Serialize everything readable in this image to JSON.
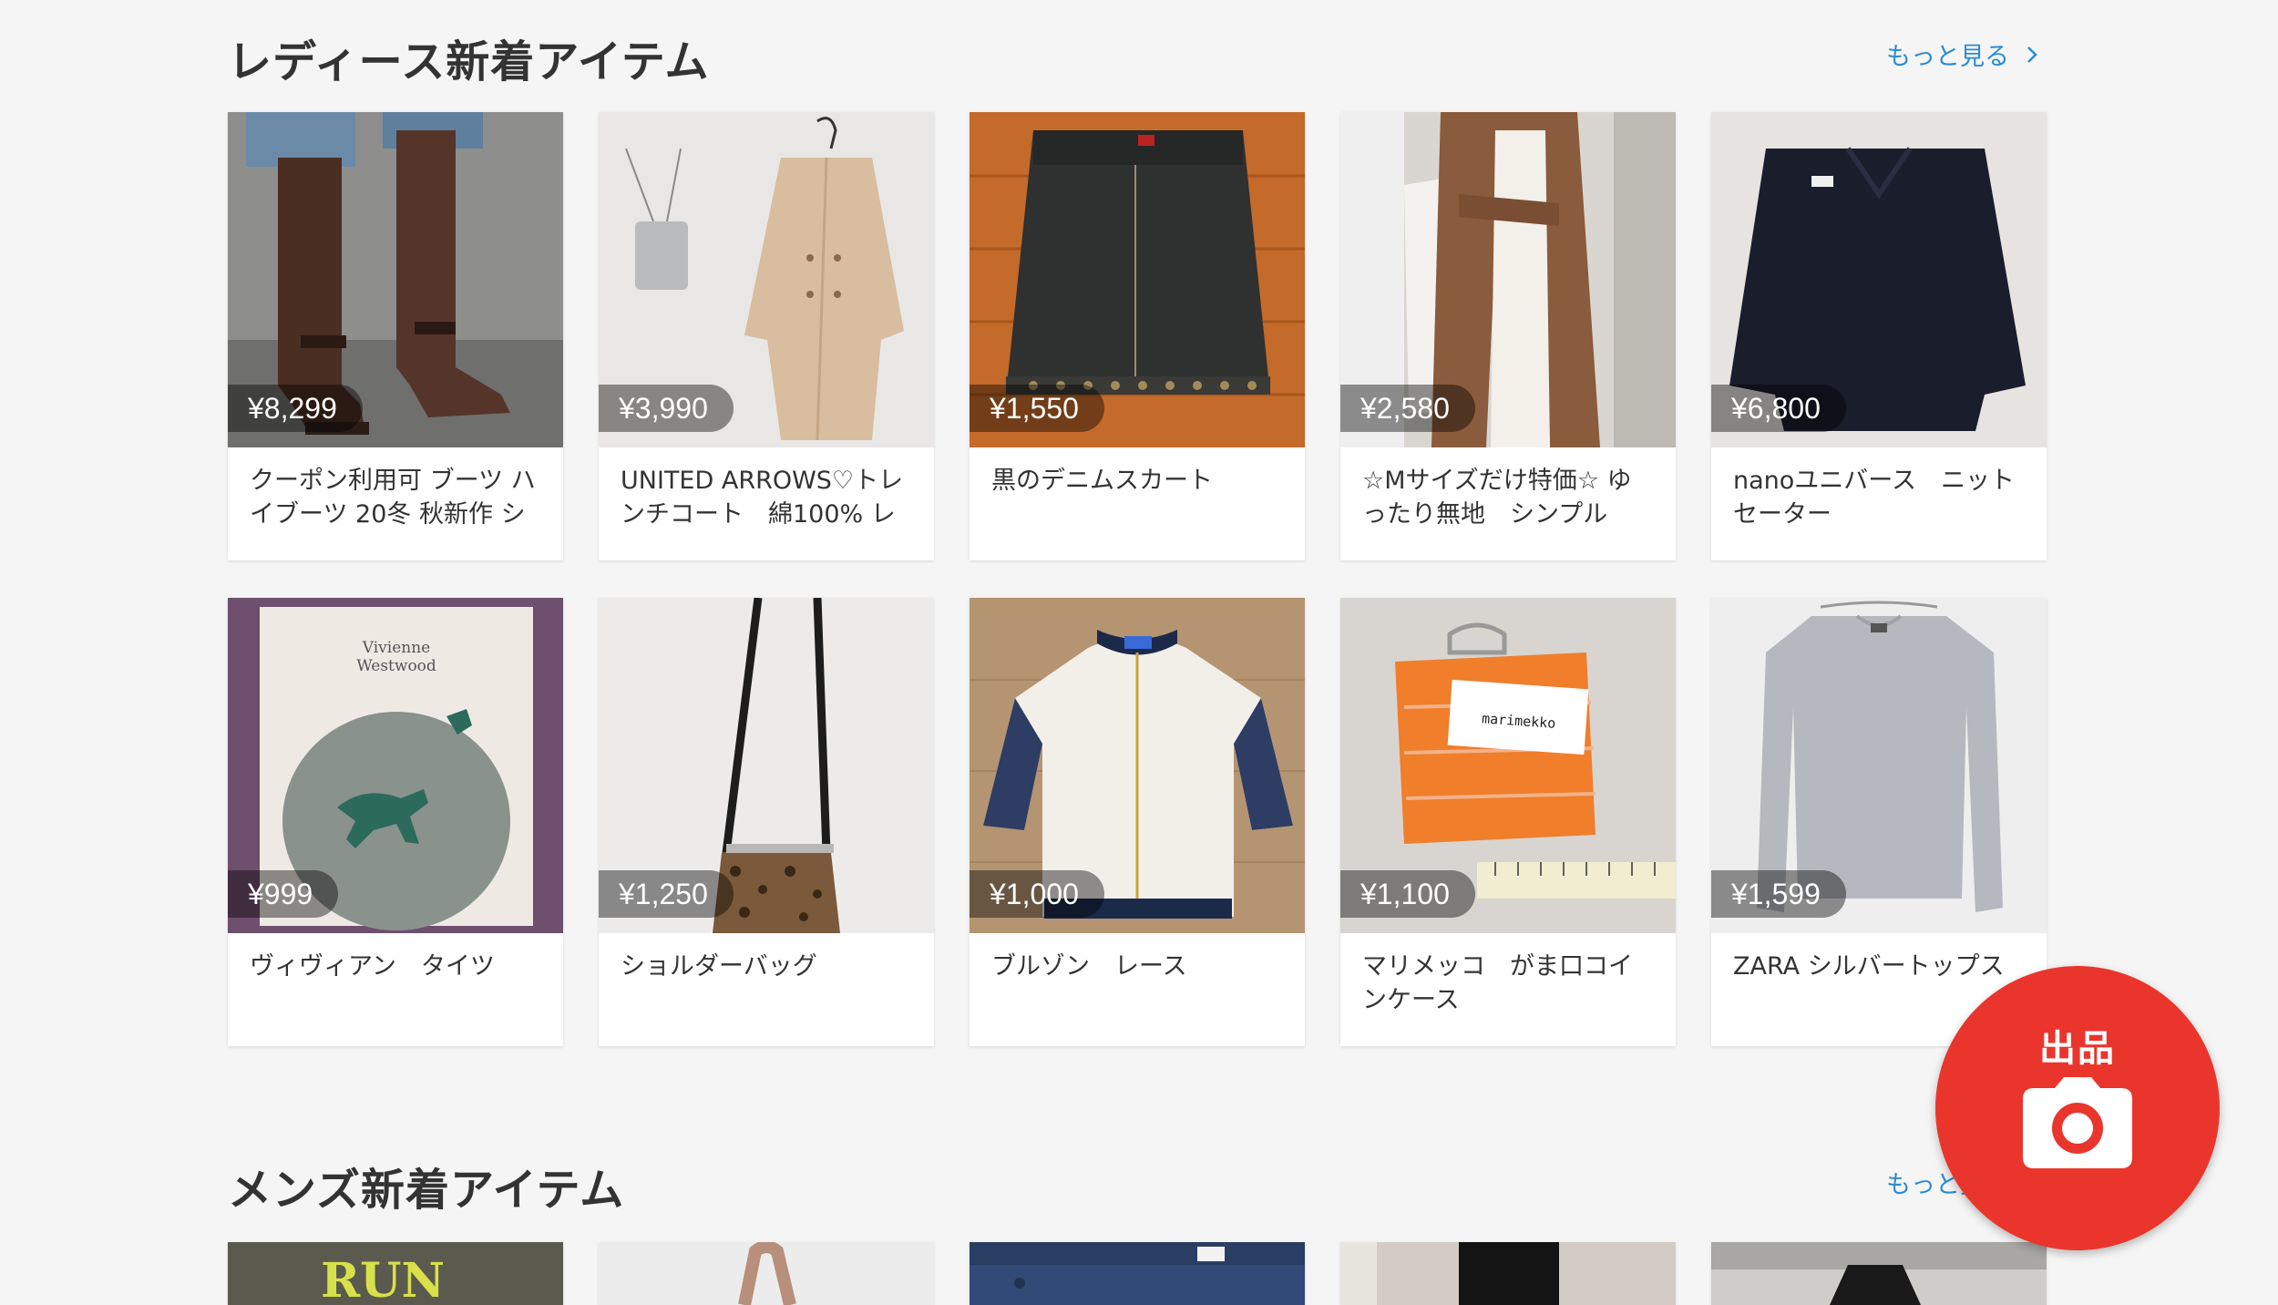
{
  "ladies": {
    "title": "レディース新着アイテム",
    "see_more": "もっと見る",
    "items": [
      {
        "price": "¥8,299",
        "name": "クーポン利用可 ブーツ ハイブーツ 20冬 秋新作 シ"
      },
      {
        "price": "¥3,990",
        "name": "UNITED ARROWS♡トレンチコート　綿100% レ"
      },
      {
        "price": "¥1,550",
        "name": "黒のデニムスカート"
      },
      {
        "price": "¥2,580",
        "name": "☆Mサイズだけ特価☆ ゆったり無地　シンプル"
      },
      {
        "price": "¥6,800",
        "name": "nanoユニバース　ニットセーター"
      },
      {
        "price": "¥999",
        "name": "ヴィヴィアン　タイツ"
      },
      {
        "price": "¥1,250",
        "name": "ショルダーバッグ"
      },
      {
        "price": "¥1,000",
        "name": "ブルゾン　レース"
      },
      {
        "price": "¥1,100",
        "name": "マリメッコ　がま口コインケース"
      },
      {
        "price": "¥1,599",
        "name": "ZARA シルバートップス"
      }
    ]
  },
  "mens": {
    "title": "メンズ新着アイテム",
    "see_more": "もっと見る"
  },
  "fab": {
    "label": "出品",
    "icon": "camera-icon",
    "color": "#ea352d"
  },
  "colors": {
    "link": "#2a8bd5",
    "background": "#f5f5f5"
  },
  "image_text": {
    "tights_brand": "Vivienne Westwood",
    "coin_case_tag": "marimekko",
    "tshirt_print": "RUN"
  }
}
